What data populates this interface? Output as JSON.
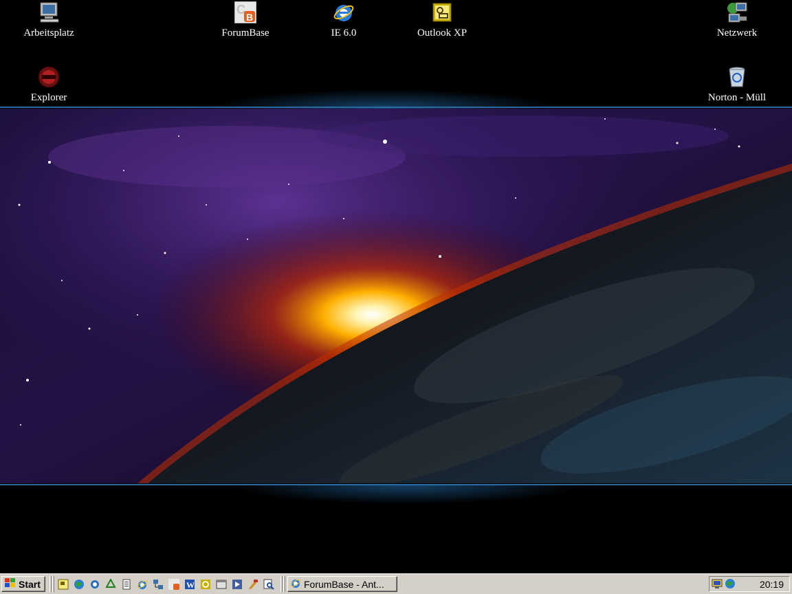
{
  "desktop": {
    "icons": [
      {
        "label": "Arbeitsplatz",
        "icon": "computer-icon"
      },
      {
        "label": "ForumBase",
        "icon": "forumbase-icon"
      },
      {
        "label": "IE 6.0",
        "icon": "internet-explorer-icon"
      },
      {
        "label": "Outlook XP",
        "icon": "outlook-icon"
      },
      {
        "label": "Netzwerk",
        "icon": "network-icon"
      },
      {
        "label": "Explorer",
        "icon": "explorer-icon"
      },
      {
        "label": "Norton - Müll",
        "icon": "recycle-bin-icon"
      }
    ]
  },
  "taskbar": {
    "start_label": "Start",
    "quick_launch": [
      "outlook-icon",
      "globe-icon",
      "search-icon",
      "recycle-icon",
      "document-icon",
      "internet-explorer-icon",
      "network-icon",
      "forumbase-icon",
      "word-icon",
      "outlook-express-icon",
      "calendar-icon",
      "media-icon",
      "tools-icon",
      "find-icon"
    ],
    "task_button_label": "ForumBase - Ant...",
    "clock": "20:19"
  },
  "colors": {
    "taskbar": "#d4d0c8",
    "desktop": "#000000",
    "accent_line": "#2a6aa0"
  }
}
